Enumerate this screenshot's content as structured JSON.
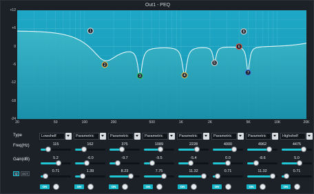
{
  "window": {
    "title": "Out1 - PEQ"
  },
  "graph": {
    "y_ticks": [
      "+12",
      "+6",
      "0",
      "-6",
      "-12",
      "-18",
      "-24"
    ],
    "x_ticks": [
      "20",
      "50",
      "100",
      "200",
      "500",
      "1K",
      "2K",
      "5K",
      "10K",
      "20K"
    ],
    "bands": [
      {
        "n": "1",
        "color": "#cccccc",
        "freq_hz": 115,
        "gain_db": 5.2
      },
      {
        "n": "2",
        "color": "#e7b84b",
        "freq_hz": 162,
        "gain_db": -6.0
      },
      {
        "n": "3",
        "color": "#33c46b",
        "freq_hz": 375,
        "gain_db": -9.7
      },
      {
        "n": "4",
        "color": "#e7b84b",
        "freq_hz": 1089,
        "gain_db": -9.5
      },
      {
        "n": "5",
        "color": "#cccccc",
        "freq_hz": 2228,
        "gain_db": -5.4
      },
      {
        "n": "6",
        "color": "#e24d3b",
        "freq_hz": 4000,
        "gain_db": 0.0
      },
      {
        "n": "7",
        "color": "#3c7ee0",
        "freq_hz": 4962,
        "gain_db": -8.6
      },
      {
        "n": "8",
        "color": "#cccccc",
        "freq_hz": 4475,
        "gain_db": 5.0
      }
    ]
  },
  "labels": {
    "type": "Type",
    "freq": "Freq(Hz)",
    "gain": "Gain(dB)",
    "link": "Q",
    "oct": "OCT"
  },
  "columns": [
    {
      "type": "Lowshelf",
      "freq": "115",
      "gain": "5.2",
      "q": "0.71",
      "freq_pos": 0.25,
      "gain_pos": 0.6,
      "q_pos": 0.15,
      "on": "ON"
    },
    {
      "type": "Parametric",
      "freq": "162",
      "gain": "-6.0",
      "q": "1.39",
      "freq_pos": 0.3,
      "gain_pos": 0.38,
      "q_pos": 0.25,
      "on": "ON"
    },
    {
      "type": "Parametric",
      "freq": "375",
      "gain": "-9.7",
      "q": "8.23",
      "freq_pos": 0.42,
      "gain_pos": 0.28,
      "q_pos": 0.7,
      "on": "ON"
    },
    {
      "type": "Parametric",
      "freq": "1089",
      "gain": "-9.5",
      "q": "7.75",
      "freq_pos": 0.55,
      "gain_pos": 0.28,
      "q_pos": 0.66,
      "on": "ON"
    },
    {
      "type": "Parametric",
      "freq": "2228",
      "gain": "-5.4",
      "q": "11.32",
      "freq_pos": 0.62,
      "gain_pos": 0.4,
      "q_pos": 0.85,
      "on": "ON"
    },
    {
      "type": "Parametric",
      "freq": "4000",
      "gain": "0.0",
      "q": "0.71",
      "freq_pos": 0.7,
      "gain_pos": 0.5,
      "q_pos": 0.15,
      "on": "ON"
    },
    {
      "type": "Parametric",
      "freq": "4962",
      "gain": "-8.6",
      "q": "11.32",
      "freq_pos": 0.73,
      "gain_pos": 0.3,
      "q_pos": 0.85,
      "on": "ON"
    },
    {
      "type": "Highshelf",
      "freq": "4475",
      "gain": "5.0",
      "q": "0.71",
      "freq_pos": 0.72,
      "gain_pos": 0.6,
      "q_pos": 0.15,
      "on": "ON"
    }
  ]
}
